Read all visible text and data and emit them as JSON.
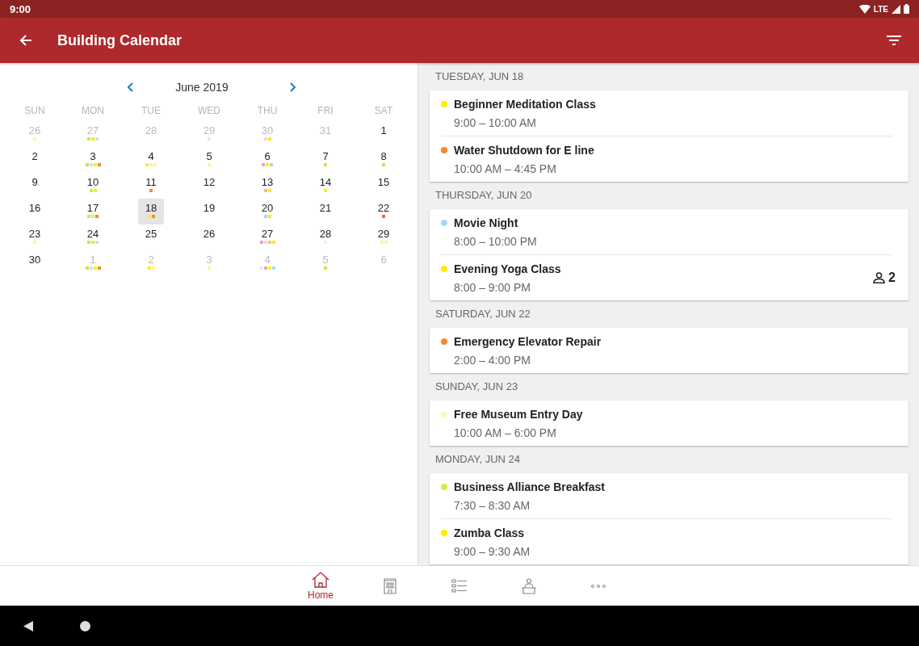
{
  "status_bar": {
    "time": "9:00",
    "network": "LTE"
  },
  "app_bar": {
    "title": "Building Calendar"
  },
  "calendar": {
    "month": "June 2019",
    "weekdays": [
      "SUN",
      "MON",
      "TUE",
      "WED",
      "THU",
      "FRI",
      "SAT"
    ],
    "weeks": [
      [
        {
          "day": "26",
          "muted": true,
          "selected": false,
          "dots": [
            {
              "color": "#fff3a0"
            }
          ]
        },
        {
          "day": "27",
          "muted": true,
          "selected": false,
          "dots": [
            {
              "color": "#c8e84a"
            },
            {
              "color": "#ffeb1a"
            },
            {
              "color": "#dcdce4"
            }
          ]
        },
        {
          "day": "28",
          "muted": true,
          "selected": false
        },
        {
          "day": "29",
          "muted": true,
          "selected": false,
          "dots": [
            {
              "color": "#e6e6e6"
            }
          ]
        },
        {
          "day": "30",
          "muted": true,
          "selected": false,
          "dots": [
            {
              "color": "#dcdce4"
            },
            {
              "color": "#ffeb1a"
            }
          ]
        },
        {
          "day": "31",
          "muted": true,
          "selected": false
        },
        {
          "day": "1",
          "muted": false,
          "selected": false
        }
      ],
      [
        {
          "day": "2",
          "muted": false,
          "selected": false
        },
        {
          "day": "3",
          "muted": false,
          "selected": false,
          "dots": [
            {
              "color": "#c8e84a"
            },
            {
              "color": "#dcdce4"
            },
            {
              "color": "#ffeb1a"
            },
            {
              "color": "#f08c30"
            }
          ]
        },
        {
          "day": "4",
          "muted": false,
          "selected": false,
          "dots": [
            {
              "color": "#ffeb1a"
            },
            {
              "color": "#fff3a0"
            },
            {
              "color": "#fff3a0"
            }
          ]
        },
        {
          "day": "5",
          "muted": false,
          "selected": false,
          "dots": [
            {
              "color": "#fff3a0"
            }
          ]
        },
        {
          "day": "6",
          "muted": false,
          "selected": false,
          "dots": [
            {
              "color": "#f0a0c0"
            },
            {
              "color": "#ffeb1a"
            },
            {
              "color": "#a8d8f0"
            }
          ]
        },
        {
          "day": "7",
          "muted": false,
          "selected": false,
          "dots": [
            {
              "color": "#c8e84a"
            }
          ]
        },
        {
          "day": "8",
          "muted": false,
          "selected": false,
          "dots": [
            {
              "color": "#c8e84a"
            }
          ]
        }
      ],
      [
        {
          "day": "9",
          "muted": false,
          "selected": false
        },
        {
          "day": "10",
          "muted": false,
          "selected": false,
          "dots": [
            {
              "color": "#c8e84a"
            },
            {
              "color": "#ffeb1a"
            }
          ]
        },
        {
          "day": "11",
          "muted": false,
          "selected": false,
          "dots": [
            {
              "color": "#f08c30"
            }
          ]
        },
        {
          "day": "12",
          "muted": false,
          "selected": false
        },
        {
          "day": "13",
          "muted": false,
          "selected": false,
          "dots": [
            {
              "color": "#f4c080"
            },
            {
              "color": "#ffeb1a"
            }
          ]
        },
        {
          "day": "14",
          "muted": false,
          "selected": false,
          "dots": [
            {
              "color": "#ffeb1a"
            }
          ]
        },
        {
          "day": "15",
          "muted": false,
          "selected": false
        }
      ],
      [
        {
          "day": "16",
          "muted": false,
          "selected": false
        },
        {
          "day": "17",
          "muted": false,
          "selected": false,
          "dots": [
            {
              "color": "#c8e84a"
            },
            {
              "color": "#ffeb1a"
            },
            {
              "color": "#f08c30"
            }
          ]
        },
        {
          "day": "18",
          "muted": false,
          "selected": true,
          "dots": [
            {
              "color": "#ffeb1a"
            },
            {
              "color": "#f08c30"
            }
          ]
        },
        {
          "day": "19",
          "muted": false,
          "selected": false
        },
        {
          "day": "20",
          "muted": false,
          "selected": false,
          "dots": [
            {
              "color": "#a8d8f0"
            },
            {
              "color": "#ffeb1a"
            }
          ]
        },
        {
          "day": "21",
          "muted": false,
          "selected": false
        },
        {
          "day": "22",
          "muted": false,
          "selected": false,
          "dots": [
            {
              "color": "#e87030"
            }
          ]
        }
      ],
      [
        {
          "day": "23",
          "muted": false,
          "selected": false,
          "dots": [
            {
              "color": "#fff3a0"
            }
          ]
        },
        {
          "day": "24",
          "muted": false,
          "selected": false,
          "dots": [
            {
              "color": "#c8e84a"
            },
            {
              "color": "#ffeb1a"
            },
            {
              "color": "#dcdce4"
            }
          ]
        },
        {
          "day": "25",
          "muted": false,
          "selected": false
        },
        {
          "day": "26",
          "muted": false,
          "selected": false
        },
        {
          "day": "27",
          "muted": false,
          "selected": false,
          "dots": [
            {
              "color": "#f0a0c0"
            },
            {
              "color": "#dcdce4"
            },
            {
              "color": "#f4c080"
            },
            {
              "color": "#ffeb1a"
            }
          ]
        },
        {
          "day": "28",
          "muted": false,
          "selected": false,
          "dots": [
            {
              "color": "#f0f0f0"
            }
          ]
        },
        {
          "day": "29",
          "muted": false,
          "selected": false,
          "dots": [
            {
              "color": "#fff3a0"
            },
            {
              "color": "#fff3a0"
            }
          ]
        }
      ],
      [
        {
          "day": "30",
          "muted": false,
          "selected": false
        },
        {
          "day": "1",
          "muted": true,
          "selected": false,
          "dots": [
            {
              "color": "#c8e84a"
            },
            {
              "color": "#dcdce4"
            },
            {
              "color": "#ffeb1a"
            },
            {
              "color": "#f08c30"
            }
          ]
        },
        {
          "day": "2",
          "muted": true,
          "selected": false,
          "dots": [
            {
              "color": "#ffeb1a"
            },
            {
              "color": "#fff3a0"
            }
          ]
        },
        {
          "day": "3",
          "muted": true,
          "selected": false,
          "dots": [
            {
              "color": "#fff3a0"
            }
          ]
        },
        {
          "day": "4",
          "muted": true,
          "selected": false,
          "dots": [
            {
              "color": "#d8eef8"
            },
            {
              "color": "#f0a0c0"
            },
            {
              "color": "#ffeb1a"
            },
            {
              "color": "#a8d8f0"
            }
          ]
        },
        {
          "day": "5",
          "muted": true,
          "selected": false,
          "dots": [
            {
              "color": "#c8e84a"
            }
          ]
        },
        {
          "day": "6",
          "muted": true,
          "selected": false
        }
      ]
    ]
  },
  "agenda": [
    {
      "date": "TUESDAY, JUN 18",
      "events": [
        {
          "title": "Beginner Meditation Class",
          "time": "9:00 – 10:00 AM",
          "color": "#ffee00"
        },
        {
          "title": "Water Shutdown for E line",
          "time": "10:00 AM – 4:45 PM",
          "color": "#f08c30"
        }
      ]
    },
    {
      "date": "THURSDAY, JUN 20",
      "events": [
        {
          "title": "Movie Night",
          "time": "8:00 – 10:00 PM",
          "color": "#a8d8f0"
        },
        {
          "title": "Evening Yoga Class",
          "time": "8:00 – 9:00 PM",
          "color": "#ffee00",
          "attendees": "2"
        }
      ]
    },
    {
      "date": "SATURDAY, JUN 22",
      "events": [
        {
          "title": "Emergency Elevator Repair",
          "time": "2:00 – 4:00 PM",
          "color": "#f08c30"
        }
      ]
    },
    {
      "date": "SUNDAY, JUN 23",
      "events": [
        {
          "title": "Free Museum Entry Day",
          "time": "10:00 AM – 6:00 PM",
          "color": "#fff6c0"
        }
      ]
    },
    {
      "date": "MONDAY, JUN 24",
      "events": [
        {
          "title": "Business Alliance Breakfast",
          "time": "7:30 – 8:30 AM",
          "color": "#c8f050"
        },
        {
          "title": "Zumba Class",
          "time": "9:00 – 9:30 AM",
          "color": "#ffee00"
        }
      ]
    }
  ],
  "bottom_nav": [
    {
      "kind": "home",
      "label": "Home",
      "selected": true
    },
    {
      "kind": "building",
      "selected": false
    },
    {
      "kind": "list",
      "selected": false
    },
    {
      "kind": "desk",
      "selected": false
    },
    {
      "kind": "more",
      "selected": false
    }
  ]
}
